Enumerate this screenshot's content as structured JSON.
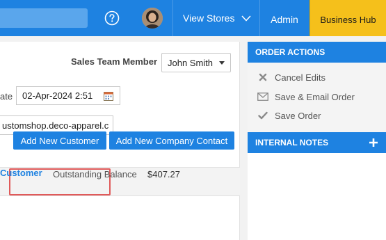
{
  "header": {
    "view_stores_label": "View Stores",
    "admin_label": "Admin",
    "business_hub_label": "Business Hub",
    "help_icon": "help-circle-icon",
    "colors": {
      "bar": "#1e82e1",
      "business_hub": "#f5c01b"
    }
  },
  "order_form": {
    "sales_team_label": "Sales Team Member",
    "sales_team_value": "John Smith",
    "date_label_fragment": "ate",
    "date_value": "02-Apr-2024 2:51",
    "store_url_value": "ustomshop.deco-apparel.c"
  },
  "actions_bar": {
    "add_new_customer_label": "Add New Customer",
    "add_new_company_contact_label": "Add New Company Contact"
  },
  "customer": {
    "link_label": "Customer",
    "outstanding_balance_label": "Outstanding Balance",
    "outstanding_balance_value": "$407.27"
  },
  "sidebar": {
    "order_actions_title": "ORDER ACTIONS",
    "actions": [
      {
        "label": "Cancel Edits",
        "icon": "close-icon"
      },
      {
        "label": "Save & Email Order",
        "icon": "envelope-icon"
      },
      {
        "label": "Save Order",
        "icon": "check-icon"
      }
    ],
    "internal_notes_title": "INTERNAL NOTES",
    "add_note_icon": "plus-icon"
  }
}
